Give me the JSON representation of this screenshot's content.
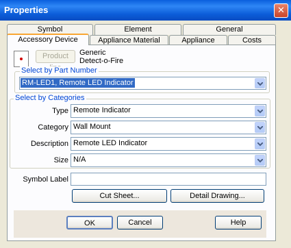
{
  "window": {
    "title": "Properties"
  },
  "tabs_row1": [
    "Symbol",
    "Element",
    "General"
  ],
  "tabs_row2": [
    "Accessory Device",
    "Appliance Material",
    "Appliance",
    "Costs"
  ],
  "header": {
    "product_line_button": "Product line",
    "manufacturer_line1": "Generic",
    "manufacturer_line2": "Detect-o-Fire"
  },
  "part_number": {
    "group_label": "Select by Part Number",
    "value": "RM-LED1, Remote LED Indicator"
  },
  "categories": {
    "group_label": "Select by Categories",
    "type_label": "Type",
    "type_value": "Remote Indicator",
    "category_label": "Category",
    "category_value": "Wall Mount",
    "description_label": "Description",
    "description_value": "Remote LED Indicator",
    "size_label": "Size",
    "size_value": "N/A"
  },
  "symbol_label": {
    "label": "Symbol Label",
    "value": ""
  },
  "buttons": {
    "cut_sheet": "Cut Sheet...",
    "detail_drawing": "Detail Drawing...",
    "ok": "OK",
    "cancel": "Cancel",
    "help": "Help"
  },
  "icons": {
    "close": "close-icon",
    "device_symbol": "device-symbol-icon",
    "dropdown": "chevron-down-icon"
  },
  "colors": {
    "title_bar": "#0A5FDD",
    "group_label": "#0046D5",
    "selection": "#316AC5",
    "active_tab_highlight": "#F9A631"
  }
}
